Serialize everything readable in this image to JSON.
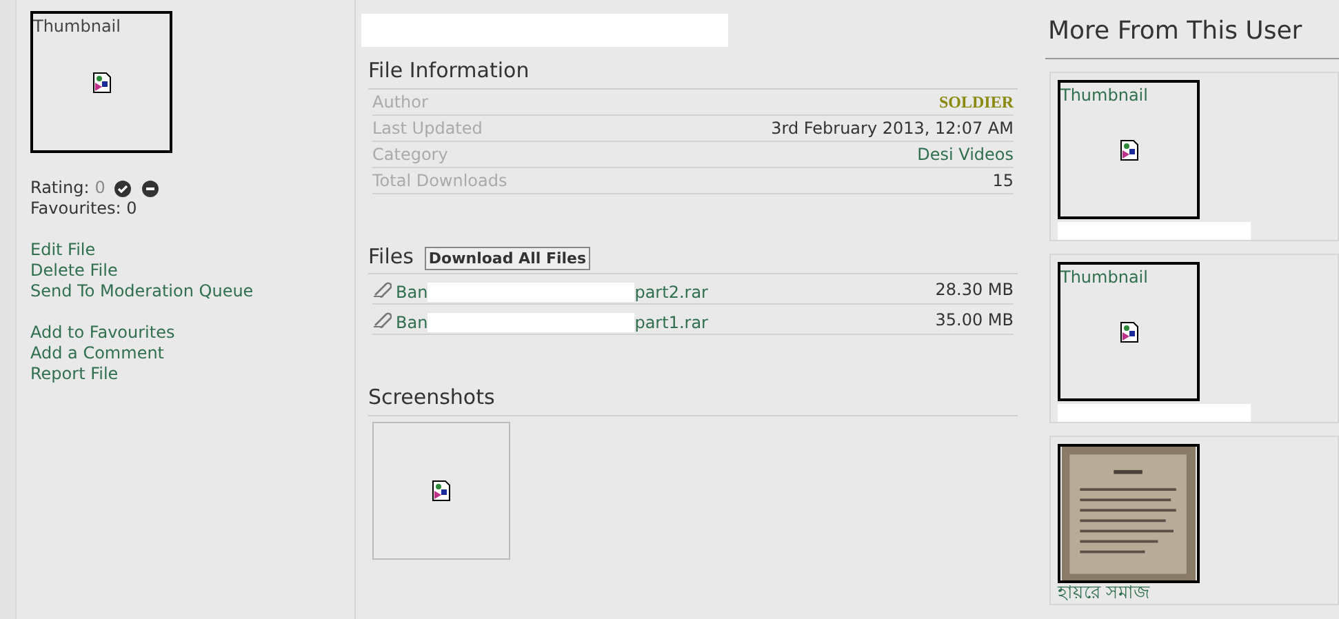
{
  "sidebar": {
    "thumbnail_label": "Thumbnail",
    "rating_label": "Rating:",
    "rating_value": "0",
    "favourites": "Favourites: 0",
    "action_groups": [
      [
        "Edit File",
        "Delete File",
        "Send To Moderation Queue"
      ],
      [
        "Add to Favourites",
        "Add a Comment",
        "Report File"
      ]
    ]
  },
  "file_information": {
    "heading": "File Information",
    "rows": [
      {
        "label": "Author",
        "value": "SOLDIER",
        "kind": "author"
      },
      {
        "label": "Last Updated",
        "value": "3rd February 2013, 12:07 AM",
        "kind": "plain"
      },
      {
        "label": "Category",
        "value": "Desi Videos",
        "kind": "link"
      },
      {
        "label": "Total Downloads",
        "value": "15",
        "kind": "plain"
      }
    ]
  },
  "files": {
    "heading": "Files",
    "download_all": "Download All Files",
    "items": [
      {
        "name_start": "Ban",
        "name_end": "part2.rar",
        "size": "28.30 MB"
      },
      {
        "name_start": "Ban",
        "name_end": "part1.rar",
        "size": "35.00 MB"
      }
    ]
  },
  "screenshots": {
    "heading": "Screenshots"
  },
  "more_from_user": {
    "heading": "More From This User",
    "items": [
      {
        "kind": "thumbnail",
        "thumbnail_label": "Thumbnail"
      },
      {
        "kind": "thumbnail",
        "thumbnail_label": "Thumbnail"
      },
      {
        "kind": "picture",
        "title": "হায়রে সমাজ"
      }
    ]
  }
}
